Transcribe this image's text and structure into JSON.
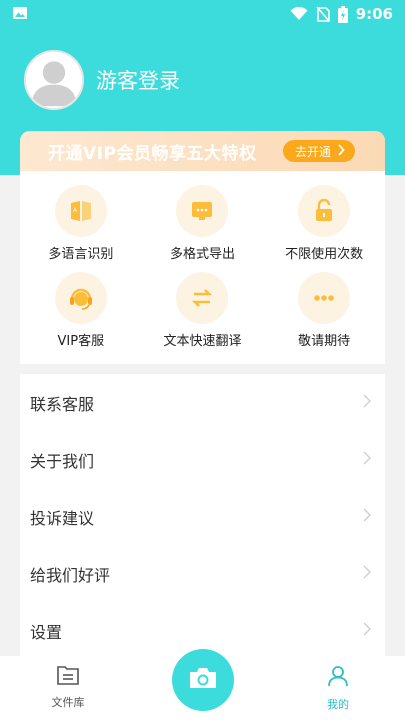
{
  "status_bar": {
    "time": "9:06",
    "icons": [
      "image-icon",
      "wifi-icon",
      "no-sim-icon",
      "battery-icon"
    ]
  },
  "profile": {
    "login_text": "游客登录",
    "avatar_icon": "user-avatar-icon"
  },
  "vip": {
    "banner_title": "开通VIP会员畅享五大特权",
    "open_button": "去开通",
    "features": [
      {
        "label": "多语言识别",
        "icon": "translate-book-icon"
      },
      {
        "label": "多格式导出",
        "icon": "export-format-icon"
      },
      {
        "label": "不限使用次数",
        "icon": "unlock-icon"
      },
      {
        "label": "VIP客服",
        "icon": "headset-icon"
      },
      {
        "label": "文本快速翻译",
        "icon": "swap-arrows-icon"
      },
      {
        "label": "敬请期待",
        "icon": "more-dots-icon"
      }
    ]
  },
  "menu": {
    "items": [
      {
        "label": "联系客服"
      },
      {
        "label": "关于我们"
      },
      {
        "label": "投诉建议"
      },
      {
        "label": "给我们好评"
      },
      {
        "label": "设置"
      }
    ]
  },
  "bottom_nav": {
    "items": [
      {
        "label": "文件库",
        "icon": "file-library-icon",
        "active": false
      },
      {
        "label": "我的",
        "icon": "profile-icon",
        "active": true
      }
    ],
    "camera_icon": "camera-icon"
  },
  "colors": {
    "primary": "#3ddcdc",
    "accent": "#fba81a",
    "active_nav": "#2bc0c4"
  }
}
